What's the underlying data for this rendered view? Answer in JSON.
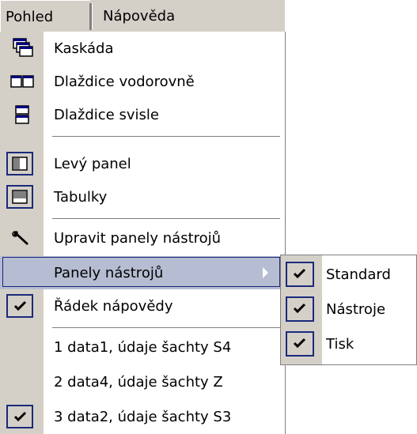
{
  "menubar": {
    "active": "Pohled",
    "next": "Nápověda"
  },
  "menu": {
    "items": [
      {
        "label": "Kaskáda",
        "icon": "cascade-windows-icon"
      },
      {
        "label": "Dlaždice vodorovně",
        "icon": "tile-horizontal-icon"
      },
      {
        "label": "Dlaždice svisle",
        "icon": "tile-vertical-icon"
      },
      {
        "label": "Levý panel",
        "icon": "left-panel-icon",
        "checked": true
      },
      {
        "label": "Tabulky",
        "icon": "tables-icon",
        "checked": true
      },
      {
        "label": "Upravit panely nástrojů",
        "icon": "wrench-icon"
      },
      {
        "label": "Panely nástrojů",
        "submenu": true,
        "highlighted": true
      },
      {
        "label": "Řádek nápovědy",
        "icon": "check-icon",
        "checked": true
      },
      {
        "label": "1 data1, údaje šachty S4"
      },
      {
        "label": "2 data4, údaje šachty Z"
      },
      {
        "label": "3 data2, údaje šachty S3",
        "icon": "check-icon",
        "checked": true
      }
    ]
  },
  "submenu": {
    "items": [
      {
        "label": "Standard",
        "checked": true
      },
      {
        "label": "Nástroje",
        "checked": true
      },
      {
        "label": "Tisk",
        "checked": true
      }
    ]
  },
  "colors": {
    "gutter": "#d4d0c8",
    "highlight": "#b6bdd2",
    "border": "#1a2a7a"
  }
}
